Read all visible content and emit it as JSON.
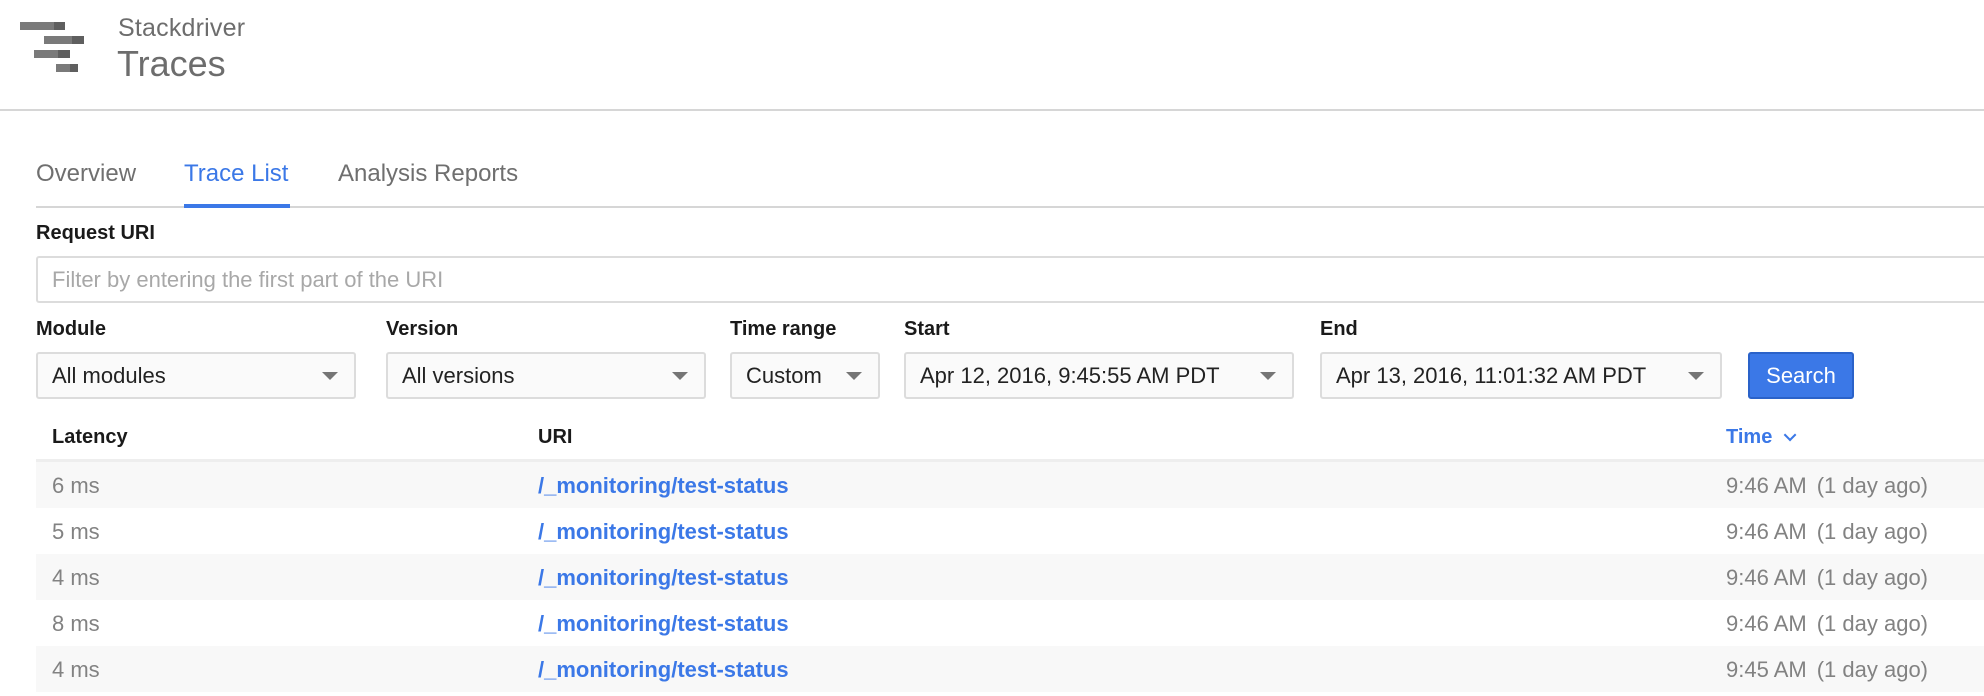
{
  "header": {
    "brand": "Stackdriver",
    "product": "Traces",
    "logo_icon": "stackdriver-trace-logo"
  },
  "tabs": [
    {
      "label": "Overview",
      "active": false
    },
    {
      "label": "Trace List",
      "active": true
    },
    {
      "label": "Analysis Reports",
      "active": false
    }
  ],
  "filters": {
    "request_uri": {
      "label": "Request URI",
      "value": "",
      "placeholder": "Filter by entering the first part of the URI"
    },
    "module": {
      "label": "Module",
      "selected": "All modules"
    },
    "version": {
      "label": "Version",
      "selected": "All versions"
    },
    "time_range": {
      "label": "Time range",
      "selected": "Custom"
    },
    "start": {
      "label": "Start",
      "selected": "Apr 12, 2016, 9:45:55 AM PDT"
    },
    "end": {
      "label": "End",
      "selected": "Apr 13, 2016, 11:01:32 AM PDT"
    },
    "search_label": "Search"
  },
  "table": {
    "columns": {
      "latency": "Latency",
      "uri": "URI",
      "time": "Time",
      "time_sort": "descending"
    },
    "rows": [
      {
        "latency": "6 ms",
        "uri": "/_monitoring/test-status",
        "time": "9:46 AM",
        "ago": "(1 day ago)"
      },
      {
        "latency": "5 ms",
        "uri": "/_monitoring/test-status",
        "time": "9:46 AM",
        "ago": "(1 day ago)"
      },
      {
        "latency": "4 ms",
        "uri": "/_monitoring/test-status",
        "time": "9:46 AM",
        "ago": "(1 day ago)"
      },
      {
        "latency": "8 ms",
        "uri": "/_monitoring/test-status",
        "time": "9:46 AM",
        "ago": "(1 day ago)"
      },
      {
        "latency": "4 ms",
        "uri": "/_monitoring/test-status",
        "time": "9:45 AM",
        "ago": "(1 day ago)"
      }
    ]
  },
  "colors": {
    "accent": "#3b78e7",
    "muted_text": "#828282",
    "row_alt": "#f8f8f8",
    "divider": "#d6d6d6"
  }
}
